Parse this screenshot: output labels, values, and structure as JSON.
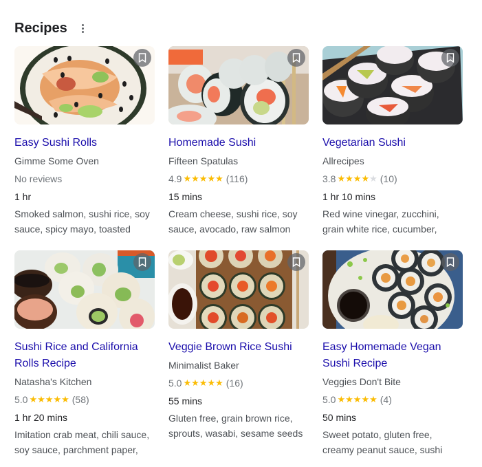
{
  "header": {
    "title": "Recipes",
    "more_icon": "more-vert-icon"
  },
  "colors": {
    "title_link": "#1a0dab",
    "star_filled": "#fbbc04",
    "star_empty": "#dadce0",
    "bookmark_bg": "#8a8d91"
  },
  "recipes": [
    {
      "title": "Easy Sushi Rolls",
      "source": "Gimme Some Oven",
      "rating_text": "No reviews",
      "rating": null,
      "reviews": null,
      "time": "1 hr",
      "ingredients": "Smoked salmon, sushi rice, soy sauce, spicy mayo, toasted",
      "image_desc": "Spicy salmon sushi roll close-up with sesame seeds",
      "bookmark_icon": "bookmark-icon"
    },
    {
      "title": "Homemade Sushi",
      "source": "Fifteen Spatulas",
      "rating_text": "4.9",
      "rating": 4.9,
      "stars_filled": 5,
      "reviews": "(116)",
      "time": "15 mins",
      "ingredients": "Cream cheese, sushi rice, soy sauce, avocado, raw salmon",
      "image_desc": "Salmon and avocado maki rolls on wooden board",
      "bookmark_icon": "bookmark-icon"
    },
    {
      "title": "Vegetarian Sushi",
      "source": "Allrecipes",
      "rating_text": "3.8",
      "rating": 3.8,
      "stars_filled": 4,
      "reviews": "(10)",
      "time": "1 hr 10 mins",
      "ingredients": "Red wine vinegar, zucchini, grain white rice, cucumber,",
      "image_desc": "Vegetable sushi rolls coated in black sesame",
      "bookmark_icon": "bookmark-icon"
    },
    {
      "title": "Sushi Rice and California Rolls Recipe",
      "source": "Natasha's Kitchen",
      "rating_text": "5.0",
      "rating": 5.0,
      "stars_filled": 5,
      "reviews": "(58)",
      "time": "1 hr 20 mins",
      "ingredients": "Imitation crab meat, chili sauce, soy sauce, parchment paper,",
      "image_desc": "California rolls with sesame and spicy mayo dip",
      "bookmark_icon": "bookmark-icon"
    },
    {
      "title": "Veggie Brown Rice Sushi",
      "source": "Minimalist Baker",
      "rating_text": "5.0",
      "rating": 5.0,
      "stars_filled": 5,
      "reviews": "(16)",
      "time": "55 mins",
      "ingredients": "Gluten free, grain brown rice, sprouts, wasabi, sesame seeds",
      "image_desc": "Brown rice veggie sushi rolls with soy sauce and wasabi",
      "bookmark_icon": "bookmark-icon"
    },
    {
      "title": "Easy Homemade Vegan Sushi Recipe",
      "source": "Veggies Don't Bite",
      "rating_text": "5.0",
      "rating": 5.0,
      "stars_filled": 5,
      "reviews": "(4)",
      "time": "50 mins",
      "ingredients": "Sweet potato, gluten free, creamy peanut sauce, sushi",
      "image_desc": "Vegan sushi rolls on plate with soy sauce and peanut sauce",
      "bookmark_icon": "bookmark-icon"
    }
  ]
}
